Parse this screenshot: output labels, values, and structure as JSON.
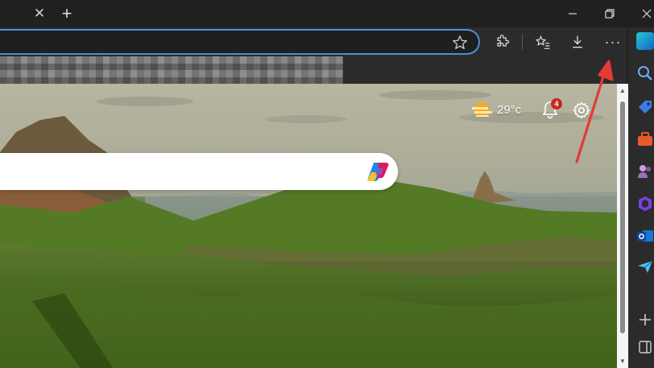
{
  "window": {
    "tab_close_glyph": "✕",
    "new_tab_glyph": "+",
    "minimize_glyph": "—",
    "restore_glyph": "❐",
    "close_glyph": "✕"
  },
  "toolbar": {
    "more_glyph": "···"
  },
  "newtab": {
    "weather_temp": "29°c",
    "notification_count": "4"
  },
  "icons": {
    "favorite_star": "star-icon",
    "extensions": "puzzle-icon",
    "favorites": "favorites-list-icon",
    "downloads": "download-icon",
    "more": "more-menu-icon",
    "copilot": "copilot-icon",
    "weather": "weather-sunny-icon",
    "notifications": "bell-icon",
    "settings": "gear-icon"
  },
  "sidebar_items": [
    "search-icon",
    "tag-icon",
    "toolbox-icon",
    "people-icon",
    "office-icon",
    "outlook-icon",
    "send-icon",
    "add-icon"
  ],
  "colors": {
    "address_focus": "#4a8fd8",
    "annotation_arrow": "#e53935",
    "badge": "#c42b1c"
  }
}
